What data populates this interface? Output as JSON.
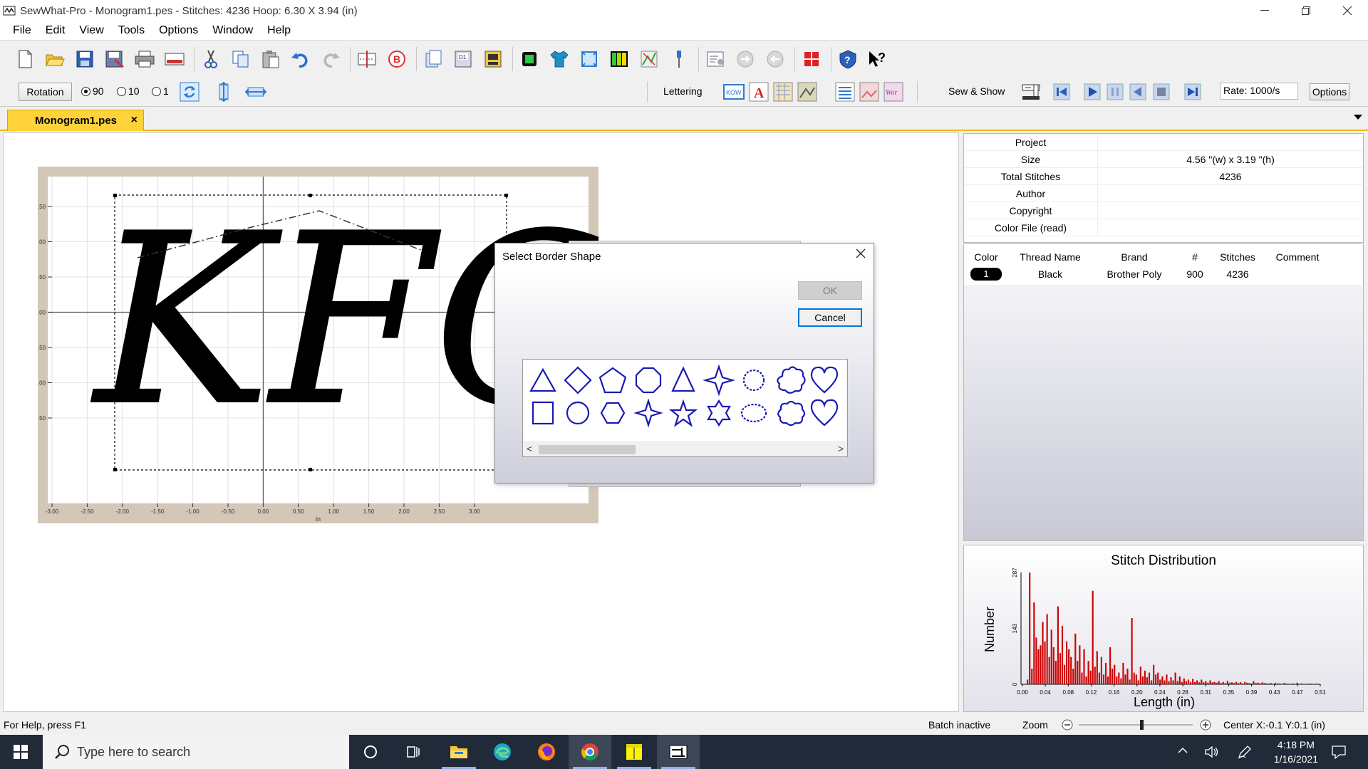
{
  "window": {
    "title": "SewWhat-Pro - Monogram1.pes - Stitches: 4236  Hoop: 6.30 X 3.94 (in)"
  },
  "menu": [
    "File",
    "Edit",
    "View",
    "Tools",
    "Options",
    "Window",
    "Help"
  ],
  "toolbar2": {
    "rotation_label": "Rotation",
    "radio_90": "90",
    "radio_10": "10",
    "radio_1": "1",
    "lettering_label": "Lettering",
    "sew_show_label": "Sew & Show",
    "rate_value": "Rate: 1000/s",
    "options_label": "Options"
  },
  "tabs": {
    "doc_tab": "Monogram1.pes",
    "close": "×"
  },
  "canvas": {
    "x_ticks": [
      "-3.00",
      "-2.50",
      "-2.00",
      "-1.50",
      "-1.00",
      "-0.50",
      "0.00",
      "0.50",
      "1.00",
      "1.50",
      "2.00",
      "2.50",
      "3.00"
    ],
    "y_ticks": [
      "1.50",
      "1.00",
      "0.50",
      "-0.00",
      "-0.50",
      "-1.00",
      "-1.50"
    ],
    "unit": "in",
    "letters": "KFC"
  },
  "properties": {
    "rows": [
      {
        "key": "Project",
        "value": ""
      },
      {
        "key": "Size",
        "value": "4.56 \"(w) x 3.19 \"(h)"
      },
      {
        "key": "Total Stitches",
        "value": "4236"
      },
      {
        "key": "Author",
        "value": ""
      },
      {
        "key": "Copyright",
        "value": ""
      },
      {
        "key": "Color File (read)",
        "value": ""
      }
    ]
  },
  "threads": {
    "headers": [
      "Color",
      "Thread Name",
      "Brand",
      "#",
      "Stitches",
      "Comment"
    ],
    "rows": [
      {
        "color": "1",
        "name": "Black",
        "brand": "Brother Poly",
        "number": "900",
        "stitches": "4236",
        "comment": ""
      }
    ]
  },
  "chart_data": {
    "type": "bar",
    "title": "Stitch Distribution",
    "xlabel": "Length (in)",
    "ylabel": "Number",
    "x_ticks": [
      "0.00",
      "0.04",
      "0.08",
      "0.12",
      "0.16",
      "0.20",
      "0.24",
      "0.28",
      "0.31",
      "0.35",
      "0.39",
      "0.43",
      "0.47",
      "0.51"
    ],
    "y_ticks": [
      "0",
      "143",
      "287"
    ],
    "ylim": [
      0,
      287
    ],
    "xlim": [
      0,
      0.51
    ],
    "bar_color": "#cc0000",
    "values": [
      0,
      0,
      12,
      287,
      40,
      210,
      120,
      90,
      100,
      160,
      110,
      180,
      70,
      140,
      95,
      60,
      200,
      80,
      150,
      50,
      110,
      90,
      70,
      40,
      130,
      60,
      100,
      30,
      90,
      20,
      60,
      35,
      240,
      45,
      85,
      30,
      70,
      25,
      55,
      20,
      95,
      40,
      50,
      20,
      30,
      15,
      55,
      25,
      40,
      12,
      170,
      30,
      25,
      10,
      45,
      20,
      35,
      18,
      30,
      10,
      50,
      25,
      30,
      12,
      20,
      10,
      25,
      8,
      18,
      10,
      30,
      8,
      20,
      6,
      15,
      8,
      12,
      6,
      14,
      6,
      10,
      5,
      12,
      5,
      8,
      4,
      10,
      5,
      6,
      4,
      8,
      3,
      6,
      3,
      9,
      4,
      5,
      3,
      6,
      3,
      5,
      2,
      6,
      4,
      3,
      2,
      8,
      3,
      4,
      2,
      5,
      3,
      2,
      2,
      3,
      1,
      4,
      2,
      2,
      1,
      3,
      2,
      1,
      1,
      2,
      1,
      4,
      1,
      2,
      1,
      1,
      0,
      2,
      1,
      1,
      0,
      1
    ]
  },
  "statusbar": {
    "help": "For Help, press F1",
    "batch": "Batch inactive",
    "zoom_label": "Zoom",
    "zoom_level": 0.55,
    "center": "Center X:-0.1  Y:0.1 (in)"
  },
  "dialog": {
    "title": "Select Border Shape",
    "ok": "OK",
    "cancel": "Cancel",
    "shapes_row1": [
      "triangle",
      "diamond",
      "pentagon",
      "octagon",
      "narrow-triangle",
      "four-point-star",
      "scalloped-circle",
      "flower",
      "heart"
    ],
    "shapes_row2": [
      "square",
      "circle",
      "hexagon",
      "four-point-star-thin",
      "five-point-star",
      "six-point-star",
      "scalloped-oval",
      "cloud",
      "heart-rounded"
    ],
    "scroll_left": "<",
    "scroll_right": ">"
  },
  "taskbar": {
    "search_placeholder": "Type here to search",
    "time": "4:18 PM",
    "date": "1/16/2021"
  }
}
